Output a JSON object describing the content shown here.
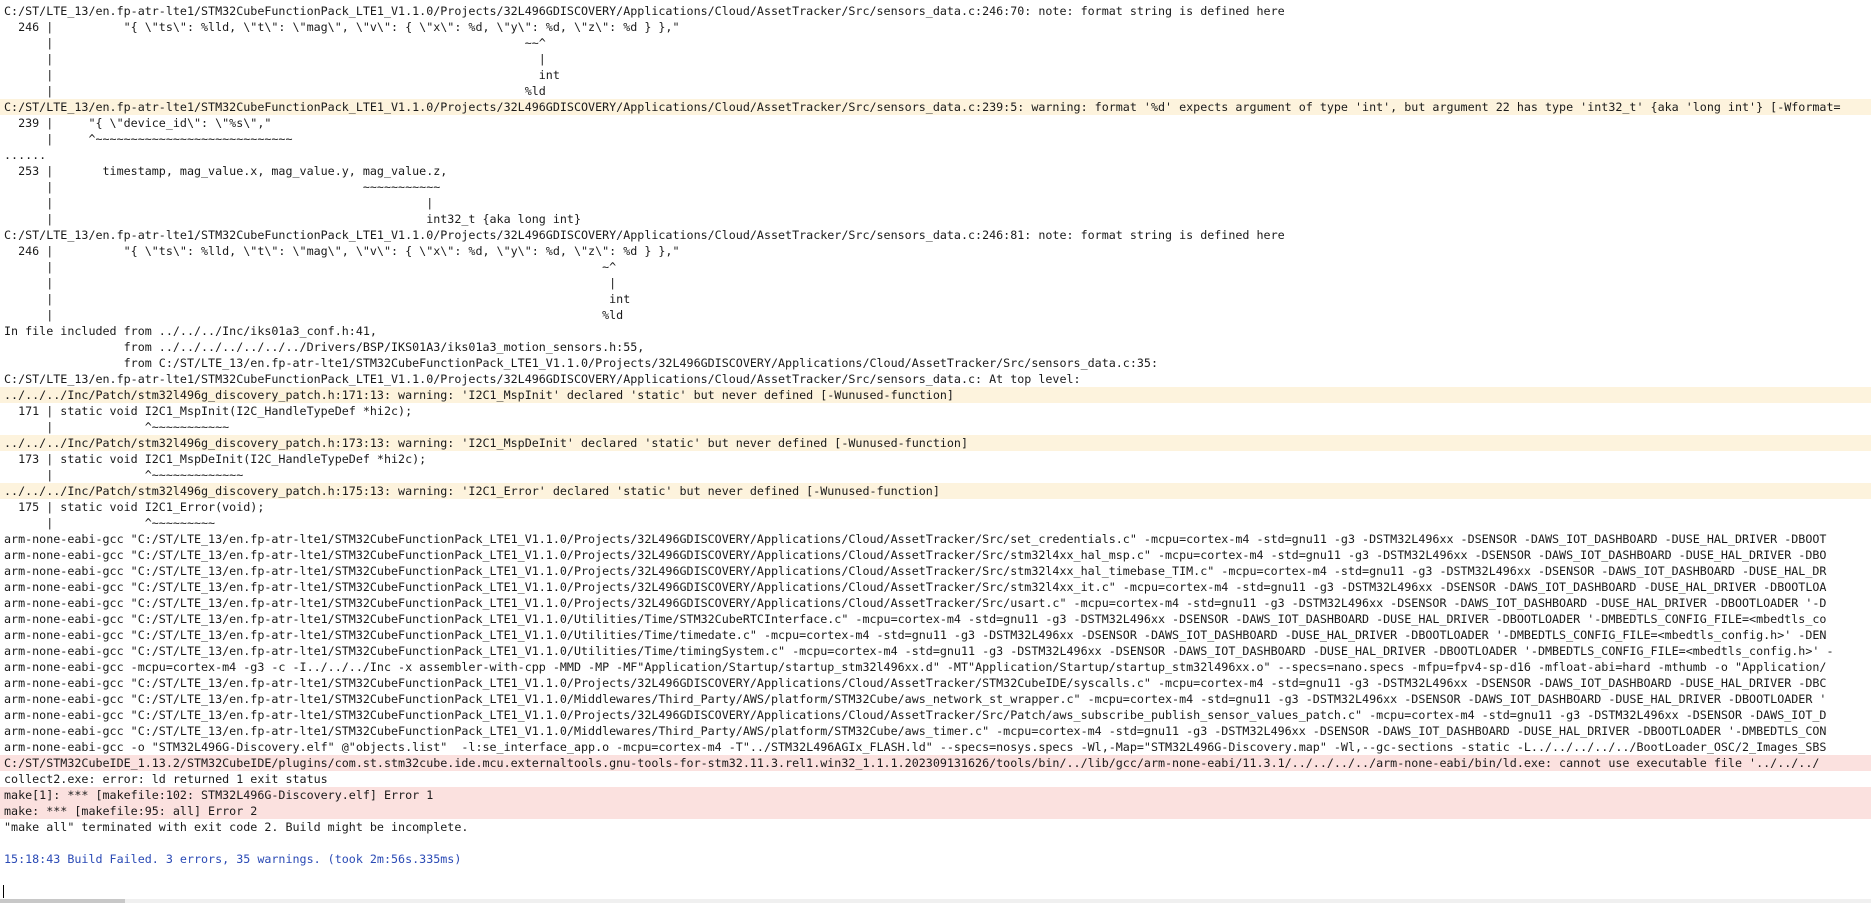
{
  "console": {
    "lines": [
      {
        "type": "note",
        "text": "C:/ST/LTE_13/en.fp-atr-lte1/STM32CubeFunctionPack_LTE1_V1.1.0/Projects/32L496GDISCOVERY/Applications/Cloud/AssetTracker/Src/sensors_data.c:246:70: note: format string is defined here"
      },
      {
        "type": "plain",
        "text": "  246 |          \"{ \\\"ts\\\": %lld, \\\"t\\\": \\\"mag\\\", \\\"v\\\": { \\\"x\\\": %d, \\\"y\\\": %d, \\\"z\\\": %d } },\""
      },
      {
        "type": "plain",
        "text": "      |                                                                   ~~^"
      },
      {
        "type": "plain",
        "text": "      |                                                                     |"
      },
      {
        "type": "plain",
        "text": "      |                                                                     int"
      },
      {
        "type": "plain",
        "text": "      |                                                                   %ld"
      },
      {
        "type": "warning",
        "text": "C:/ST/LTE_13/en.fp-atr-lte1/STM32CubeFunctionPack_LTE1_V1.1.0/Projects/32L496GDISCOVERY/Applications/Cloud/AssetTracker/Src/sensors_data.c:239:5: warning: format '%d' expects argument of type 'int', but argument 22 has type 'int32_t' {aka 'long int'} [-Wformat="
      },
      {
        "type": "plain",
        "text": "  239 |     \"{ \\\"device_id\\\": \\\"%s\\\",\""
      },
      {
        "type": "plain",
        "text": "      |     ^~~~~~~~~~~~~~~~~~~~~~~~~~~~~"
      },
      {
        "type": "plain",
        "text": "......"
      },
      {
        "type": "plain",
        "text": "  253 |       timestamp, mag_value.x, mag_value.y, mag_value.z,"
      },
      {
        "type": "plain",
        "text": "      |                                            ~~~~~~~~~~~"
      },
      {
        "type": "plain",
        "text": "      |                                                     |"
      },
      {
        "type": "plain",
        "text": "      |                                                     int32_t {aka long int}"
      },
      {
        "type": "note",
        "text": "C:/ST/LTE_13/en.fp-atr-lte1/STM32CubeFunctionPack_LTE1_V1.1.0/Projects/32L496GDISCOVERY/Applications/Cloud/AssetTracker/Src/sensors_data.c:246:81: note: format string is defined here"
      },
      {
        "type": "plain",
        "text": "  246 |          \"{ \\\"ts\\\": %lld, \\\"t\\\": \\\"mag\\\", \\\"v\\\": { \\\"x\\\": %d, \\\"y\\\": %d, \\\"z\\\": %d } },\""
      },
      {
        "type": "plain",
        "text": "      |                                                                              ~^"
      },
      {
        "type": "plain",
        "text": "      |                                                                               |"
      },
      {
        "type": "plain",
        "text": "      |                                                                               int"
      },
      {
        "type": "plain",
        "text": "      |                                                                              %ld"
      },
      {
        "type": "plain",
        "text": "In file included from ../../../Inc/iks01a3_conf.h:41,"
      },
      {
        "type": "plain",
        "text": "                 from ../../../../../../../Drivers/BSP/IKS01A3/iks01a3_motion_sensors.h:55,"
      },
      {
        "type": "plain",
        "text": "                 from C:/ST/LTE_13/en.fp-atr-lte1/STM32CubeFunctionPack_LTE1_V1.1.0/Projects/32L496GDISCOVERY/Applications/Cloud/AssetTracker/Src/sensors_data.c:35:"
      },
      {
        "type": "note",
        "text": "C:/ST/LTE_13/en.fp-atr-lte1/STM32CubeFunctionPack_LTE1_V1.1.0/Projects/32L496GDISCOVERY/Applications/Cloud/AssetTracker/Src/sensors_data.c: At top level:"
      },
      {
        "type": "warning",
        "text": "../../../Inc/Patch/stm32l496g_discovery_patch.h:171:13: warning: 'I2C1_MspInit' declared 'static' but never defined [-Wunused-function]"
      },
      {
        "type": "plain",
        "text": "  171 | static void I2C1_MspInit(I2C_HandleTypeDef *hi2c);"
      },
      {
        "type": "plain",
        "text": "      |             ^~~~~~~~~~~~"
      },
      {
        "type": "warning",
        "text": "../../../Inc/Patch/stm32l496g_discovery_patch.h:173:13: warning: 'I2C1_MspDeInit' declared 'static' but never defined [-Wunused-function]"
      },
      {
        "type": "plain",
        "text": "  173 | static void I2C1_MspDeInit(I2C_HandleTypeDef *hi2c);"
      },
      {
        "type": "plain",
        "text": "      |             ^~~~~~~~~~~~~~"
      },
      {
        "type": "warning",
        "text": "../../../Inc/Patch/stm32l496g_discovery_patch.h:175:13: warning: 'I2C1_Error' declared 'static' but never defined [-Wunused-function]"
      },
      {
        "type": "plain",
        "text": "  175 | static void I2C1_Error(void);"
      },
      {
        "type": "plain",
        "text": "      |             ^~~~~~~~~~"
      },
      {
        "type": "plain",
        "text": "arm-none-eabi-gcc \"C:/ST/LTE_13/en.fp-atr-lte1/STM32CubeFunctionPack_LTE1_V1.1.0/Projects/32L496GDISCOVERY/Applications/Cloud/AssetTracker/Src/set_credentials.c\" -mcpu=cortex-m4 -std=gnu11 -g3 -DSTM32L496xx -DSENSOR -DAWS_IOT_DASHBOARD -DUSE_HAL_DRIVER -DBOOT"
      },
      {
        "type": "plain",
        "text": "arm-none-eabi-gcc \"C:/ST/LTE_13/en.fp-atr-lte1/STM32CubeFunctionPack_LTE1_V1.1.0/Projects/32L496GDISCOVERY/Applications/Cloud/AssetTracker/Src/stm32l4xx_hal_msp.c\" -mcpu=cortex-m4 -std=gnu11 -g3 -DSTM32L496xx -DSENSOR -DAWS_IOT_DASHBOARD -DUSE_HAL_DRIVER -DBO"
      },
      {
        "type": "plain",
        "text": "arm-none-eabi-gcc \"C:/ST/LTE_13/en.fp-atr-lte1/STM32CubeFunctionPack_LTE1_V1.1.0/Projects/32L496GDISCOVERY/Applications/Cloud/AssetTracker/Src/stm32l4xx_hal_timebase_TIM.c\" -mcpu=cortex-m4 -std=gnu11 -g3 -DSTM32L496xx -DSENSOR -DAWS_IOT_DASHBOARD -DUSE_HAL_DR"
      },
      {
        "type": "plain",
        "text": "arm-none-eabi-gcc \"C:/ST/LTE_13/en.fp-atr-lte1/STM32CubeFunctionPack_LTE1_V1.1.0/Projects/32L496GDISCOVERY/Applications/Cloud/AssetTracker/Src/stm32l4xx_it.c\" -mcpu=cortex-m4 -std=gnu11 -g3 -DSTM32L496xx -DSENSOR -DAWS_IOT_DASHBOARD -DUSE_HAL_DRIVER -DBOOTLOA"
      },
      {
        "type": "plain",
        "text": "arm-none-eabi-gcc \"C:/ST/LTE_13/en.fp-atr-lte1/STM32CubeFunctionPack_LTE1_V1.1.0/Projects/32L496GDISCOVERY/Applications/Cloud/AssetTracker/Src/usart.c\" -mcpu=cortex-m4 -std=gnu11 -g3 -DSTM32L496xx -DSENSOR -DAWS_IOT_DASHBOARD -DUSE_HAL_DRIVER -DBOOTLOADER '-D"
      },
      {
        "type": "plain",
        "text": "arm-none-eabi-gcc \"C:/ST/LTE_13/en.fp-atr-lte1/STM32CubeFunctionPack_LTE1_V1.1.0/Utilities/Time/STM32CubeRTCInterface.c\" -mcpu=cortex-m4 -std=gnu11 -g3 -DSTM32L496xx -DSENSOR -DAWS_IOT_DASHBOARD -DUSE_HAL_DRIVER -DBOOTLOADER '-DMBEDTLS_CONFIG_FILE=<mbedtls_co"
      },
      {
        "type": "plain",
        "text": "arm-none-eabi-gcc \"C:/ST/LTE_13/en.fp-atr-lte1/STM32CubeFunctionPack_LTE1_V1.1.0/Utilities/Time/timedate.c\" -mcpu=cortex-m4 -std=gnu11 -g3 -DSTM32L496xx -DSENSOR -DAWS_IOT_DASHBOARD -DUSE_HAL_DRIVER -DBOOTLOADER '-DMBEDTLS_CONFIG_FILE=<mbedtls_config.h>' -DEN"
      },
      {
        "type": "plain",
        "text": "arm-none-eabi-gcc \"C:/ST/LTE_13/en.fp-atr-lte1/STM32CubeFunctionPack_LTE1_V1.1.0/Utilities/Time/timingSystem.c\" -mcpu=cortex-m4 -std=gnu11 -g3 -DSTM32L496xx -DSENSOR -DAWS_IOT_DASHBOARD -DUSE_HAL_DRIVER -DBOOTLOADER '-DMBEDTLS_CONFIG_FILE=<mbedtls_config.h>' -"
      },
      {
        "type": "plain",
        "text": "arm-none-eabi-gcc -mcpu=cortex-m4 -g3 -c -I../../../Inc -x assembler-with-cpp -MMD -MP -MF\"Application/Startup/startup_stm32l496xx.d\" -MT\"Application/Startup/startup_stm32l496xx.o\" --specs=nano.specs -mfpu=fpv4-sp-d16 -mfloat-abi=hard -mthumb -o \"Application/"
      },
      {
        "type": "plain",
        "text": "arm-none-eabi-gcc \"C:/ST/LTE_13/en.fp-atr-lte1/STM32CubeFunctionPack_LTE1_V1.1.0/Projects/32L496GDISCOVERY/Applications/Cloud/AssetTracker/STM32CubeIDE/syscalls.c\" -mcpu=cortex-m4 -std=gnu11 -g3 -DSTM32L496xx -DSENSOR -DAWS_IOT_DASHBOARD -DUSE_HAL_DRIVER -DBC"
      },
      {
        "type": "plain",
        "text": "arm-none-eabi-gcc \"C:/ST/LTE_13/en.fp-atr-lte1/STM32CubeFunctionPack_LTE1_V1.1.0/Middlewares/Third_Party/AWS/platform/STM32Cube/aws_network_st_wrapper.c\" -mcpu=cortex-m4 -std=gnu11 -g3 -DSTM32L496xx -DSENSOR -DAWS_IOT_DASHBOARD -DUSE_HAL_DRIVER -DBOOTLOADER '"
      },
      {
        "type": "plain",
        "text": "arm-none-eabi-gcc \"C:/ST/LTE_13/en.fp-atr-lte1/STM32CubeFunctionPack_LTE1_V1.1.0/Projects/32L496GDISCOVERY/Applications/Cloud/AssetTracker/Src/Patch/aws_subscribe_publish_sensor_values_patch.c\" -mcpu=cortex-m4 -std=gnu11 -g3 -DSTM32L496xx -DSENSOR -DAWS_IOT_D"
      },
      {
        "type": "plain",
        "text": "arm-none-eabi-gcc \"C:/ST/LTE_13/en.fp-atr-lte1/STM32CubeFunctionPack_LTE1_V1.1.0/Middlewares/Third_Party/AWS/platform/STM32Cube/aws_timer.c\" -mcpu=cortex-m4 -std=gnu11 -g3 -DSTM32L496xx -DSENSOR -DAWS_IOT_DASHBOARD -DUSE_HAL_DRIVER -DBOOTLOADER '-DMBEDTLS_CON"
      },
      {
        "type": "plain",
        "text": "arm-none-eabi-gcc -o \"STM32L496G-Discovery.elf\" @\"objects.list\"  -l:se_interface_app.o -mcpu=cortex-m4 -T\"../STM32L496AGIx_FLASH.ld\" --specs=nosys.specs -Wl,-Map=\"STM32L496G-Discovery.map\" -Wl,--gc-sections -static -L../../../../../BootLoader_OSC/2_Images_SBS"
      },
      {
        "type": "error",
        "text": "C:/ST/STM32CubeIDE_1.13.2/STM32CubeIDE/plugins/com.st.stm32cube.ide.mcu.externaltools.gnu-tools-for-stm32.11.3.rel1.win32_1.1.1.202309131626/tools/bin/../lib/gcc/arm-none-eabi/11.3.1/../../../../arm-none-eabi/bin/ld.exe: cannot use executable file '../../../"
      },
      {
        "type": "plain",
        "text": "collect2.exe: error: ld returned 1 exit status"
      },
      {
        "type": "error",
        "text": "make[1]: *** [makefile:102: STM32L496G-Discovery.elf] Error 1"
      },
      {
        "type": "error",
        "text": "make: *** [makefile:95: all] Error 2"
      },
      {
        "type": "plain",
        "text": "\"make all\" terminated with exit code 2. Build might be incomplete."
      },
      {
        "type": "plain",
        "text": ""
      },
      {
        "type": "info",
        "text": "15:18:43 Build Failed. 3 errors, 35 warnings. (took 2m:56s.335ms)"
      },
      {
        "type": "plain",
        "text": ""
      },
      {
        "type": "cursor",
        "text": ""
      }
    ]
  }
}
